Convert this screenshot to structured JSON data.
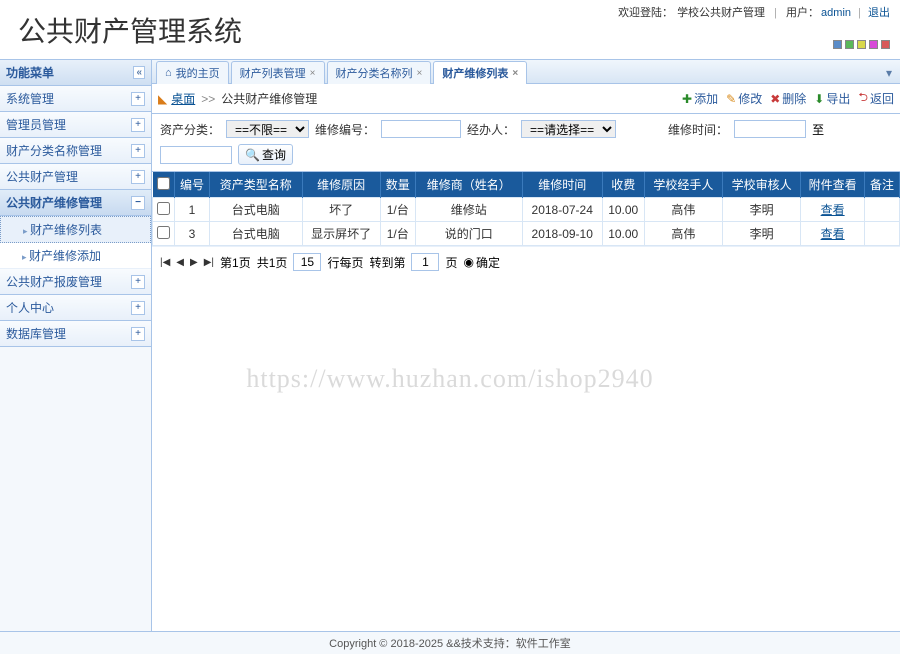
{
  "system_title": "公共财产管理系统",
  "header": {
    "welcome": "欢迎登陆：",
    "welcome_role": "学校公共财产管理",
    "user_label": "用户：",
    "username": "admin",
    "logout": "退出"
  },
  "color_squares": [
    "#5a8cc8",
    "#5ab85a",
    "#d8d84a",
    "#d84ad8",
    "#d85a5a"
  ],
  "sidebar": {
    "title": "功能菜单",
    "items": [
      {
        "label": "系统管理",
        "expand": "+"
      },
      {
        "label": "管理员管理",
        "expand": "+"
      },
      {
        "label": "财产分类名称管理",
        "expand": "+"
      },
      {
        "label": "公共财产管理",
        "expand": "+"
      },
      {
        "label": "公共财产维修管理",
        "expand": "−",
        "active": true,
        "children": [
          {
            "label": "财产维修列表",
            "active": true
          },
          {
            "label": "财产维修添加"
          }
        ]
      },
      {
        "label": "公共财产报废管理",
        "expand": "+"
      },
      {
        "label": "个人中心",
        "expand": "+"
      },
      {
        "label": "数据库管理",
        "expand": "+"
      }
    ]
  },
  "tabs": [
    {
      "label": "我的主页",
      "icon": "⌂",
      "closable": false
    },
    {
      "label": "财产列表管理",
      "closable": true
    },
    {
      "label": "财产分类名称列",
      "closable": true
    },
    {
      "label": "财产维修列表",
      "closable": true,
      "active": true
    }
  ],
  "breadcrumb": {
    "home": "桌面",
    "sep": ">>",
    "title": "公共财产维修管理"
  },
  "toolbar": {
    "add": "添加",
    "edit": "修改",
    "delete": "删除",
    "export": "导出",
    "back": "返回"
  },
  "filter": {
    "cat_label": "资产分类：",
    "cat_value": "==不限==",
    "repair_no_label": "维修编号：",
    "handler_label": "经办人：",
    "handler_value": "==请选择==",
    "time_label": "维修时间：",
    "to": "至",
    "search": "查询"
  },
  "table": {
    "headers": [
      "",
      "编号",
      "资产类型名称",
      "维修原因",
      "数量",
      "维修商（姓名）",
      "维修时间",
      "收费",
      "学校经手人",
      "学校审核人",
      "附件查看",
      "备注"
    ],
    "rows": [
      {
        "id": "1",
        "type": "台式电脑",
        "reason": "坏了",
        "qty": "1/台",
        "vendor": "维修站",
        "date": "2018-07-24",
        "fee": "10.00",
        "handler": "高伟",
        "auditor": "李明",
        "view": "查看",
        "note": ""
      },
      {
        "id": "3",
        "type": "台式电脑",
        "reason": "显示屏坏了",
        "qty": "1/台",
        "vendor": "说的门口",
        "date": "2018-09-10",
        "fee": "10.00",
        "handler": "高伟",
        "auditor": "李明",
        "view": "查看",
        "note": ""
      }
    ]
  },
  "pager": {
    "page_prefix": "第",
    "page_num": "1",
    "page_suffix": "页",
    "total_prefix": "共",
    "total": "1",
    "total_suffix": "页",
    "per_page": "15",
    "per_page_label": "行每页",
    "goto_label": "转到第",
    "goto_val": "1",
    "goto_suffix": "页",
    "ok": "确定"
  },
  "footer": "Copyright © 2018-2025 &&技术支持：软件工作室",
  "watermark": "https://www.huzhan.com/ishop2940"
}
